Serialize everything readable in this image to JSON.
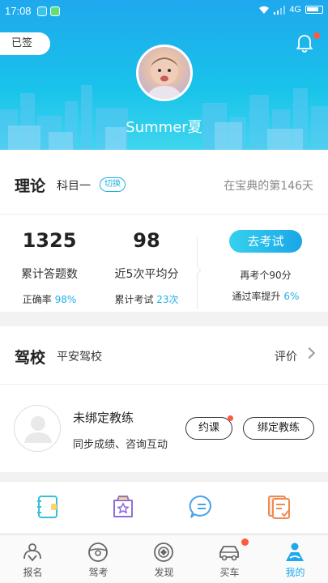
{
  "status_bar": {
    "time": "17:08",
    "network": "4G"
  },
  "header": {
    "signed_label": "已签",
    "username": "Summer夏"
  },
  "theory": {
    "title": "理论",
    "subject": "科目一",
    "switch_label": "切换",
    "days_text": "在宝典的第146天",
    "answered_count": "1325",
    "answered_label": "累计答题数",
    "accuracy_label": "正确率",
    "accuracy_value": "98%",
    "avg_score": "98",
    "avg_label": "近5次平均分",
    "exam_count_label": "累计考试",
    "exam_count_value": "23次",
    "exam_button": "去考试",
    "retake_text": "再考个90分",
    "pass_rate_label": "通过率提升",
    "pass_rate_value": "6%"
  },
  "school": {
    "title": "驾校",
    "name": "平安驾校",
    "review_label": "评价",
    "coach_title": "未绑定教练",
    "coach_desc": "同步成绩、咨询互动",
    "book_button": "约课",
    "bind_button": "绑定教练"
  },
  "tabs": [
    {
      "label": "报名"
    },
    {
      "label": "驾考"
    },
    {
      "label": "发现"
    },
    {
      "label": "买车"
    },
    {
      "label": "我的"
    }
  ],
  "colors": {
    "accent": "#1fb0e6",
    "badge": "#ff5a3c"
  }
}
